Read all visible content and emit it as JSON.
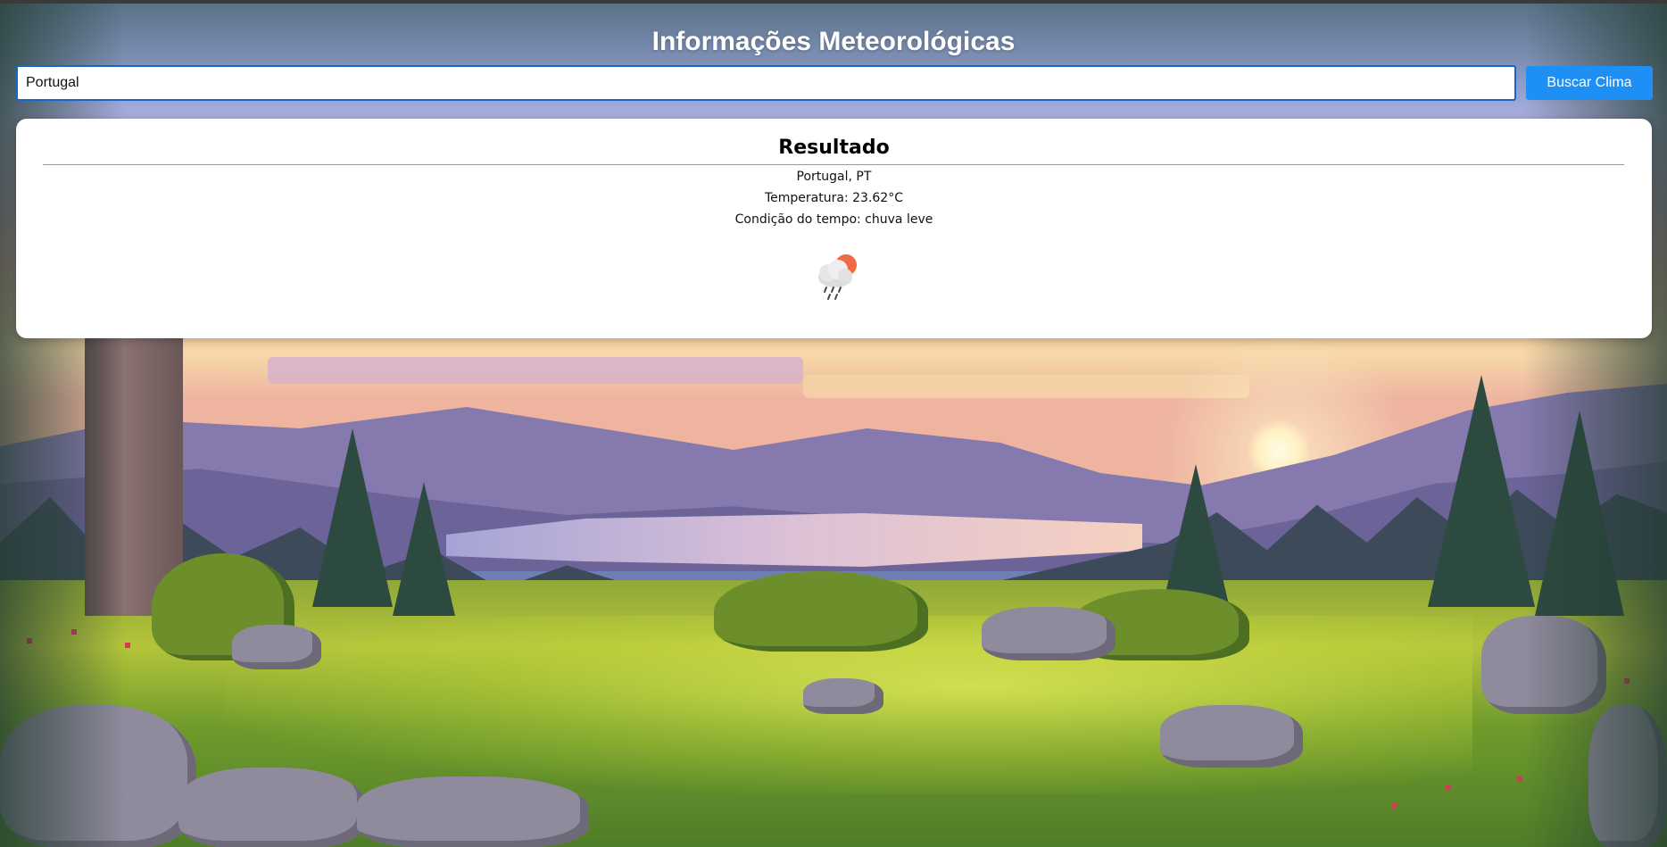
{
  "header": {
    "title": "Informações Meteorológicas"
  },
  "search": {
    "value": "Portugal",
    "button_label": "Buscar Clima"
  },
  "result": {
    "title": "Resultado",
    "location": "Portugal, PT",
    "temperature": "Temperatura: 23.62°C",
    "condition": "Condição do tempo: chuva leve",
    "icon": "rain-cloud-sun-icon"
  },
  "colors": {
    "button": "#1e8ff5",
    "input_border": "#1f7be0",
    "card": "#ffffff",
    "title_text": "#ffffff"
  }
}
